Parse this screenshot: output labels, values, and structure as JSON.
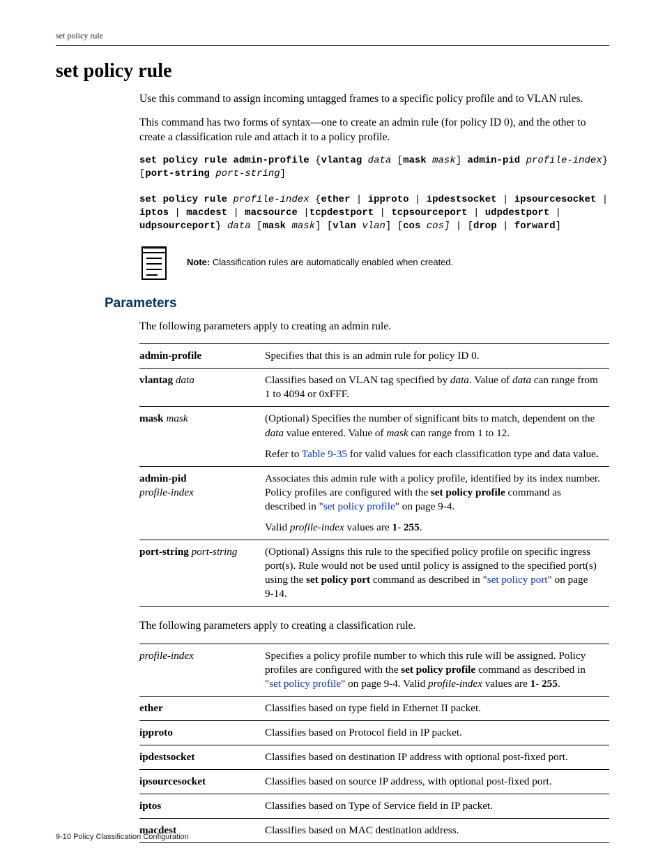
{
  "running_header": "set policy rule",
  "title": "set policy rule",
  "intro": [
    "Use this command to assign incoming untagged frames to a specific policy profile and to VLAN rules.",
    "This command has two forms of syntax—one to create an admin rule (for policy ID 0), and the other to create a classification rule and attach it to a policy profile."
  ],
  "syntax1": {
    "t1": "set policy rule admin-profile",
    "t2": "vlantag",
    "t3": "data",
    "t4": "mask",
    "t5": "mask",
    "t6": "admin-pid",
    "t7": "profile-index",
    "t8": "port-string",
    "t9": "port-string"
  },
  "syntax2": {
    "t1": "set policy rule",
    "t2": "profile-index",
    "t3": "ether",
    "t4": "ipproto",
    "t5": "ipdestsocket",
    "t6": "ipsourcesocket",
    "t7": "iptos",
    "t8": "macdest",
    "t9": "macsource",
    "t10": "tcpdestport",
    "t11": "tcpsourceport",
    "t12": "udpdestport",
    "t13": "udpsourceport",
    "t14": "data",
    "t15": "mask",
    "t16": "mask",
    "t17": "vlan",
    "t18": "vlan",
    "t19": "cos",
    "t20": "cos]",
    "t21": "drop",
    "t22": "forward"
  },
  "note": {
    "label": "Note:",
    "text": "Classification rules are automatically enabled when created."
  },
  "parameters_heading": "Parameters",
  "parameters_intro_admin": "The following parameters apply to creating an admin rule.",
  "parameters_intro_class": "The following parameters apply to creating a classification rule.",
  "admin_table": {
    "r1": {
      "term_b": "admin-profile",
      "desc": "Specifies that this is an admin rule for policy ID 0."
    },
    "r2": {
      "term_b": "vlantag",
      "term_i": "data",
      "d1": "Classifies based on VLAN tag specified by ",
      "d2": "data",
      "d3": ". Value of ",
      "d4": "data",
      "d5": " can range from 1 to 4094 or 0xFFF."
    },
    "r3": {
      "term_b": "mask",
      "term_i": "mask",
      "d1": "(Optional) Specifies the number of significant bits to match, dependent on the ",
      "d2": "data",
      "d3": " value entered. Value of ",
      "d4": "mask",
      "d5": " can range from 1 to 12.",
      "s1": "Refer to ",
      "s2": "Table 9‑35",
      "s3": " for valid values for each classification type and data value",
      "s4": "."
    },
    "r4": {
      "term_b": "admin-pid",
      "term_i": "profile-index",
      "d1": "Associates this admin rule with a policy profile, identified by its index number. Policy profiles are configured with the ",
      "d2": "set policy profile",
      "d3": " command as described in \"",
      "d4": "set policy profile",
      "d5": "\" on page 9‑4.",
      "s1": "Valid ",
      "s2": "profile-index",
      "s3": " values are ",
      "s4": "1",
      "s5": "- ",
      "s6": "255",
      "s7": "."
    },
    "r5": {
      "term_b": "port-string",
      "term_i": "port-string",
      "d1": "(Optional) Assigns this rule to the specified policy profile on specific ingress port(s). Rule would not be used until policy is assigned to the specified port(s) using the ",
      "d2": "set policy port",
      "d3": " command as described in \"",
      "d4": "set policy port",
      "d5": "\" on page 9‑14."
    }
  },
  "class_table": {
    "r1": {
      "term_i": "profile-index",
      "d1": "Specifies a policy profile number to which this rule will be assigned. Policy profiles are configured with the ",
      "d2": "set policy profile",
      "d3": " command as described in \"",
      "d4": "set policy profile",
      "d5": "\" on page 9‑4. Valid ",
      "d6": "profile-index",
      "d7": " values are ",
      "d8": "1",
      "d9": "- ",
      "d10": "255",
      "d11": "."
    },
    "r2": {
      "term_b": "ether",
      "desc": "Classifies based on type field in Ethernet II packet."
    },
    "r3": {
      "term_b": "ipproto",
      "desc": "Classifies based on Protocol field in IP packet."
    },
    "r4": {
      "term_b": "ipdestsocket",
      "desc": "Classifies based on destination IP address with optional post-fixed port."
    },
    "r5": {
      "term_b": "ipsourcesocket",
      "desc": "Classifies based on source IP address, with optional post-fixed port."
    },
    "r6": {
      "term_b": "iptos",
      "desc": "Classifies based on Type of Service field in IP packet."
    },
    "r7": {
      "term_b": "macdest",
      "desc": "Classifies based on MAC destination address."
    }
  },
  "footer": "9-10   Policy Classification Configuration"
}
